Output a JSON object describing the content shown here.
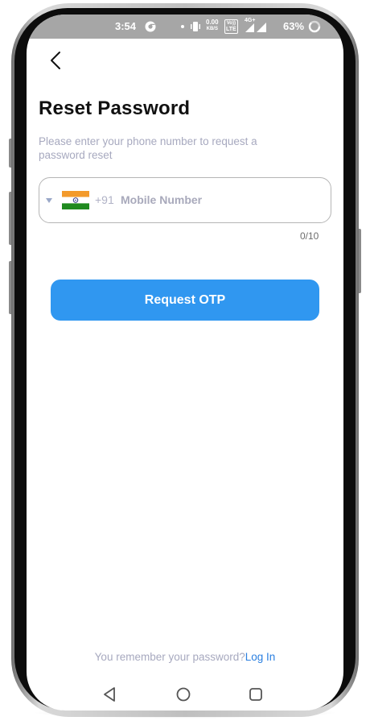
{
  "status_bar": {
    "time": "3:54",
    "net_speed_value": "0.00",
    "net_speed_unit": "KB/S",
    "volte_top": "Vo))",
    "volte_bottom": "LTE",
    "network": "4G+",
    "battery": "63%"
  },
  "page": {
    "title": "Reset Password",
    "subtitle": "Please enter your phone number to request a password reset"
  },
  "phone_field": {
    "country_code": "+91",
    "placeholder": "Mobile Number",
    "counter": "0/10"
  },
  "actions": {
    "request_otp": "Request OTP"
  },
  "footer": {
    "prompt": "You remember your password?",
    "login": "Log In"
  },
  "icons": {
    "back": "chevron-left-icon",
    "nav_back": "triangle-back-icon",
    "nav_home": "circle-home-icon",
    "nav_recents": "square-recents-icon"
  },
  "colors": {
    "accent": "#3097f0",
    "link": "#2a7fe0",
    "muted_text": "#a7a9bf",
    "status_bar": "#a6a6a6"
  }
}
